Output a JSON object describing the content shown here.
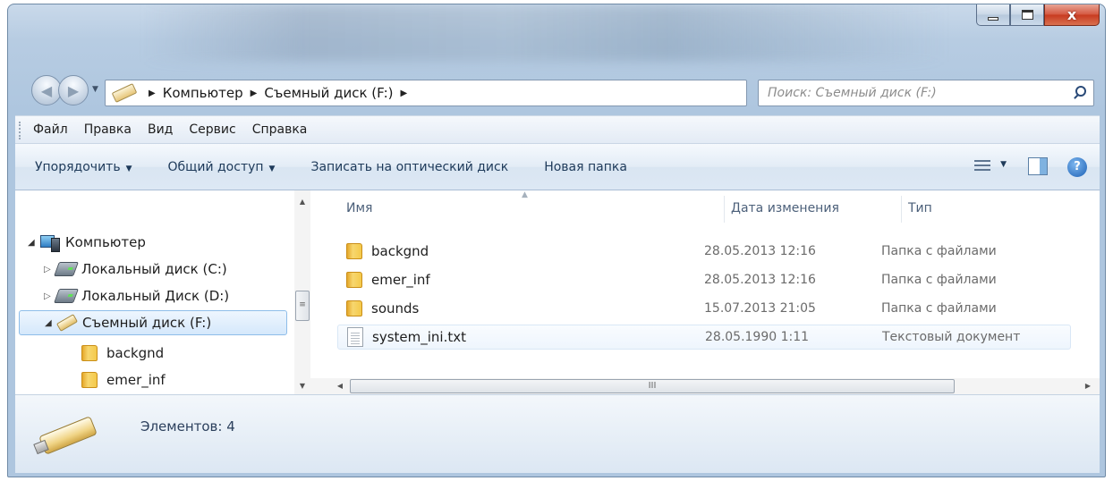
{
  "window": {
    "caption_min": "",
    "caption_max": "",
    "caption_close": "x"
  },
  "address": {
    "crumbs": [
      "Компьютер",
      "Съемный диск (F:)"
    ]
  },
  "search": {
    "placeholder": "Поиск: Съемный диск (F:)"
  },
  "menu": [
    "Файл",
    "Правка",
    "Вид",
    "Сервис",
    "Справка"
  ],
  "toolbar": {
    "organize": "Упорядочить",
    "share": "Общий доступ",
    "burn": "Записать на оптический диск",
    "new_folder": "Новая папка"
  },
  "nav_tree": [
    {
      "label": "Компьютер",
      "icon": "computer-icon",
      "expanded": true
    },
    {
      "label": "Локальный диск (C:)",
      "icon": "hdd-icon",
      "expanded": false
    },
    {
      "label": "Локальный Диск (D:)",
      "icon": "hdd-icon",
      "expanded": false
    },
    {
      "label": "Съемный диск (F:)",
      "icon": "usb-drive-icon",
      "expanded": true,
      "selected": true
    },
    {
      "label": "backgnd",
      "icon": "folder-icon"
    },
    {
      "label": "emer_inf",
      "icon": "folder-icon"
    }
  ],
  "columns": {
    "name": "Имя",
    "date": "Дата изменения",
    "type": "Тип"
  },
  "files": [
    {
      "name": "backgnd",
      "date": "28.05.2013 12:16",
      "type": "Папка с файлами",
      "icon": "folder-icon"
    },
    {
      "name": "emer_inf",
      "date": "28.05.2013 12:16",
      "type": "Папка с файлами",
      "icon": "folder-icon"
    },
    {
      "name": "sounds",
      "date": "15.07.2013 21:05",
      "type": "Папка с файлами",
      "icon": "folder-icon"
    },
    {
      "name": "system_ini.txt",
      "date": "28.05.1990 1:11",
      "type": "Текстовый документ",
      "icon": "text-file-icon"
    }
  ],
  "scrollbar_grip": "III",
  "details": {
    "items_count": "Элементов: 4"
  },
  "colors": {
    "window_frame": "#b7cce2",
    "close_button": "#c73a20",
    "selection": "#d5e8fb"
  }
}
